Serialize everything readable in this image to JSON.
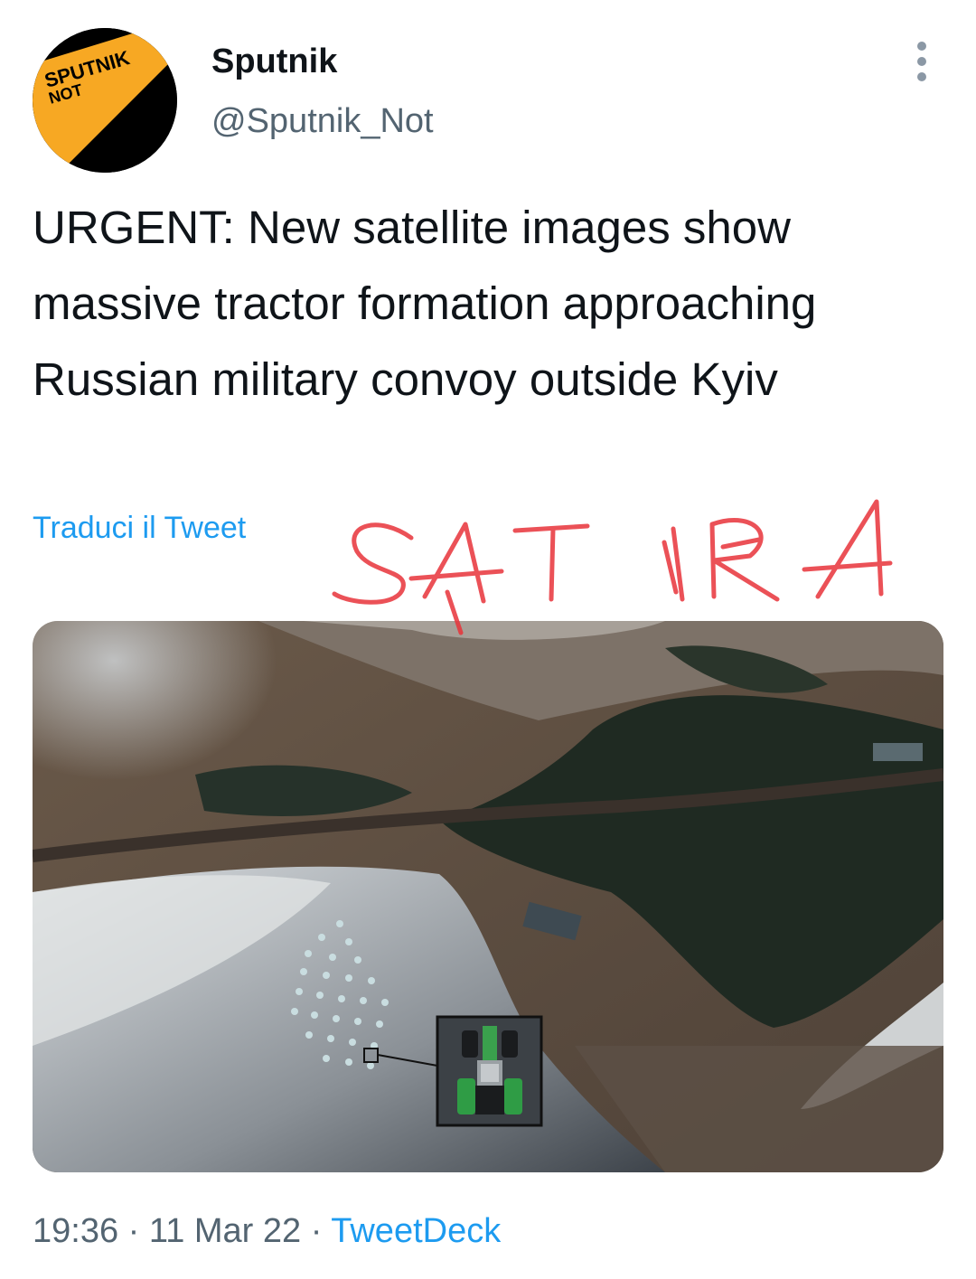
{
  "tweet": {
    "author": {
      "display_name": "Sputnik",
      "handle": "@Sputnik_Not",
      "avatar_text": [
        "SPUTNIK",
        "NOT"
      ]
    },
    "text": "URGENT: New satellite images show massive tractor formation approaching Russian military convoy outside Kyiv",
    "translate_label": "Traduci il Tweet",
    "overlay_text": "SATIRA",
    "timestamp": {
      "time": "19:36",
      "separator": "·",
      "date": "11 Mar 22",
      "source": "TweetDeck"
    },
    "more_icon": "more-vertical-icon"
  },
  "colors": {
    "text_primary": "#0f1419",
    "text_secondary": "#536471",
    "link": "#1d9bf0",
    "avatar_bg": "#000000",
    "avatar_accent": "#f7a823",
    "annotation": "#e8333a"
  }
}
